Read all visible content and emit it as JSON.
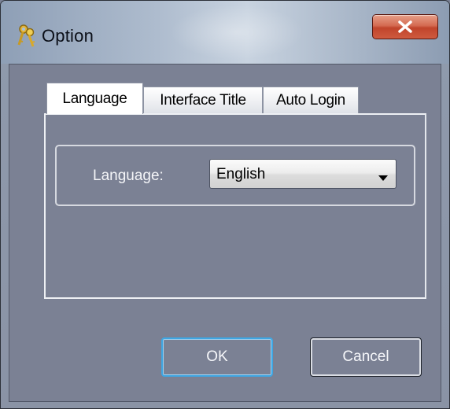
{
  "window": {
    "title": "Option",
    "icon": "keys-icon",
    "close_icon": "close-x-icon"
  },
  "tabs": [
    {
      "label": "Language",
      "active": true
    },
    {
      "label": "Interface Title",
      "active": false
    },
    {
      "label": "Auto Login",
      "active": false
    }
  ],
  "language_group": {
    "label": "Language:",
    "selected": "English",
    "dropdown_icon": "dropdown-arrow-icon"
  },
  "buttons": {
    "ok": "OK",
    "cancel": "Cancel"
  },
  "colors": {
    "client_bg": "#7b8194",
    "close_button": "#c8462d",
    "focus_border": "#3fa6e2"
  }
}
